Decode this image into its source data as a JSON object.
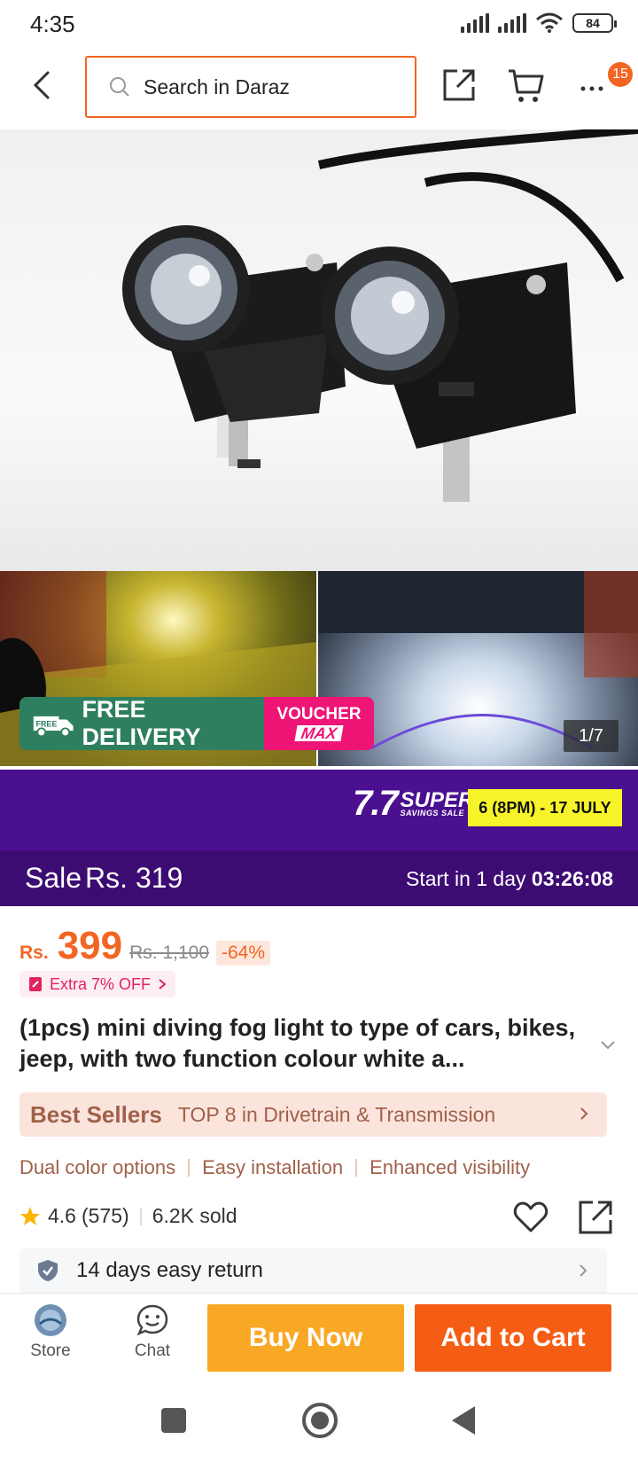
{
  "status": {
    "time": "4:35",
    "battery": "84"
  },
  "header": {
    "search_placeholder": "Search in Daraz",
    "notification_count": "15"
  },
  "gallery": {
    "counter": "1/7",
    "free_delivery": "FREE DELIVERY",
    "free_tag": "FREE",
    "voucher_line1": "VOUCHER",
    "voucher_line2": "MAX"
  },
  "promo": {
    "logo_number": "7.7",
    "logo_super": "SUPER",
    "logo_sub": "SAVINGS SALE",
    "date": "6 (8PM) - 17 JULY",
    "sale_label": "Sale",
    "sale_price": "Rs. 319",
    "start_prefix": "Start in 1 day",
    "start_timer": "03:26:08"
  },
  "price": {
    "currency": "Rs.",
    "value": "399",
    "original": "Rs. 1,100",
    "discount": "-64%",
    "extra_off": "Extra 7% OFF"
  },
  "product": {
    "title": "(1pcs) mini diving fog light to type of cars, bikes, jeep, with two function colour white a..."
  },
  "bestseller": {
    "badge": "Best Sellers",
    "text": "TOP 8 in Drivetrain & Transmission"
  },
  "features": [
    "Dual color options",
    "Easy installation",
    "Enhanced visibility"
  ],
  "rating": {
    "score": "4.6",
    "count": "(575)",
    "sold": "6.2K sold"
  },
  "return_policy": {
    "text": "14 days easy return"
  },
  "actions": {
    "store": "Store",
    "chat": "Chat",
    "buy_now": "Buy Now",
    "add_to_cart": "Add to Cart"
  },
  "colors": {
    "brand_orange": "#f26522",
    "promo_purple": "#4a108f",
    "buy_now": "#f9a825",
    "add_to_cart": "#f55d14"
  }
}
